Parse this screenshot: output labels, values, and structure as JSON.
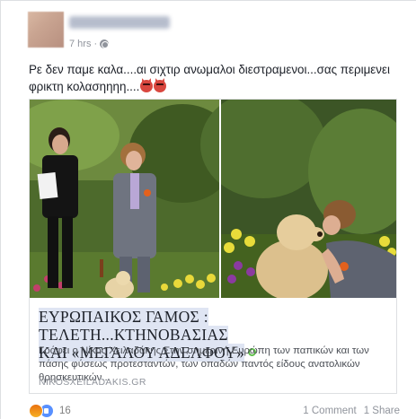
{
  "post": {
    "time": "7 hrs",
    "separator": "·",
    "text_line1": "Ρε δεν παμε καλα....αι σιχτιρ ανωμαλοι διεστραμενοι...σας περιμενει",
    "text_line2": "φρικτη κολασηηηη...."
  },
  "link_preview": {
    "title_line1": "ΕΥΡΩΠΑΙΚΟΣ ΓΑΜΟΣ : ΤΕΛΕΤΗ...ΚΤΗΝΟΒΑΣΙΑΣ",
    "title_line2": "ΚΑΙ «ΜΕΓΑΛΟΥ ΑΔΕΛΦΟΥ»",
    "description": "Γράφει ο Νίκος Χειλαδάκης Στην σημερινή Ευρώπη των παπικών και των πάσης φύσεως προτεσταντών, των οπαδών παντός είδους ανατολικών θρησκευτικών...",
    "domain": "NIKOSXEILADAKIS.GR"
  },
  "footer": {
    "reaction_count": "16",
    "comments": "1 Comment",
    "shares": "1 Share"
  },
  "icons": {
    "privacy": "globe-icon",
    "emoji": "angry-devil-icon",
    "reactions": [
      "angry-reaction-icon",
      "like-reaction-icon"
    ]
  },
  "colors": {
    "accent": "#4267b2",
    "devil": "#d9473f",
    "headline_highlight": "#dfe5f3"
  }
}
